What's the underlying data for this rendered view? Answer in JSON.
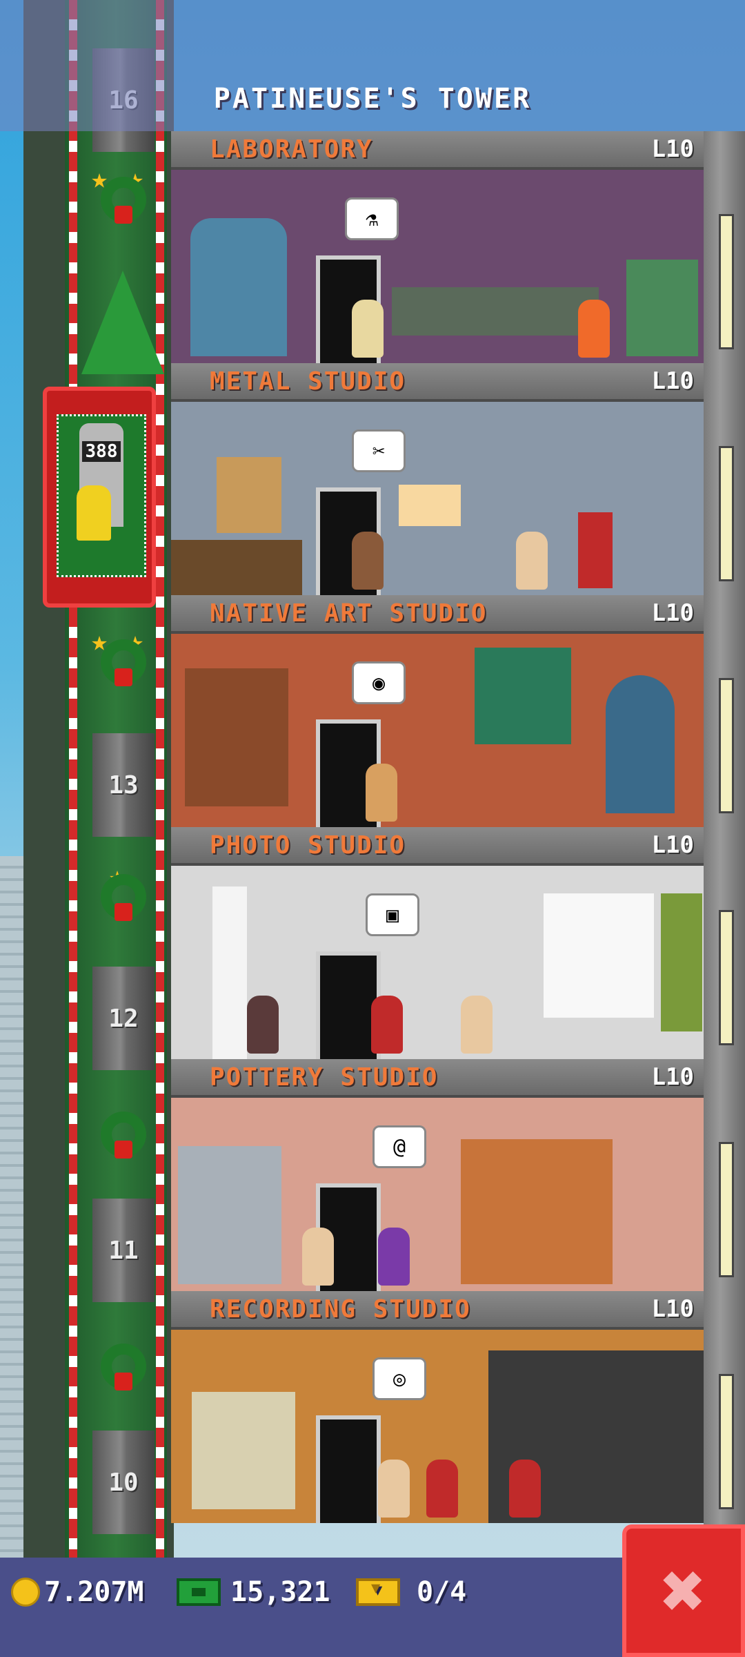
{
  "header": {
    "title": "PATINEUSE'S TOWER"
  },
  "shaft": {
    "floor_numbers": [
      "16",
      "13",
      "12",
      "11",
      "10"
    ],
    "elevator_display": "388"
  },
  "floors": [
    {
      "name": "LABORATORY",
      "level": "L10",
      "bubble_icon": "beaker-icon"
    },
    {
      "name": "METAL STUDIO",
      "level": "L10",
      "bubble_icon": "tongs-icon"
    },
    {
      "name": "NATIVE ART STUDIO",
      "level": "L10",
      "bubble_icon": "drum-icon"
    },
    {
      "name": "PHOTO STUDIO",
      "level": "L10",
      "bubble_icon": "photo-icon"
    },
    {
      "name": "POTTERY STUDIO",
      "level": "L10",
      "bubble_icon": "spiral-icon"
    },
    {
      "name": "RECORDING STUDIO",
      "level": "L10",
      "bubble_icon": "disc-icon"
    }
  ],
  "resources": {
    "coins": "7.207M",
    "bux": "15,321",
    "vip": "0/4"
  },
  "colors": {
    "floor_label": "#f07a3a",
    "close_button": "#e02a2a",
    "bottom_bar": "#4a4f8a"
  }
}
